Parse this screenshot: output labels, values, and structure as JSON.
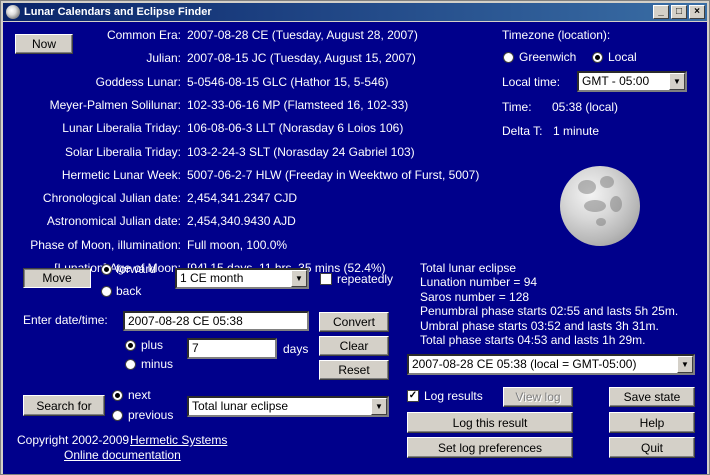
{
  "window": {
    "title": "Lunar Calendars and Eclipse Finder"
  },
  "buttons": {
    "now": "Now",
    "move": "Move",
    "convert": "Convert",
    "clear": "Clear",
    "reset": "Reset",
    "search_for": "Search for",
    "view_log": "View log",
    "save_state": "Save state",
    "log_this_result": "Log this result",
    "help": "Help",
    "set_log_preferences": "Set log preferences",
    "quit": "Quit"
  },
  "calendars": [
    {
      "label": "Common Era:",
      "value": "2007-08-28 CE (Tuesday, August 28, 2007)"
    },
    {
      "label": "Julian:",
      "value": "2007-08-15 JC (Tuesday, August 15, 2007)"
    },
    {
      "label": "Goddess Lunar:",
      "value": "5-0546-08-15 GLC (Hathor 15, 5-546)"
    },
    {
      "label": "Meyer-Palmen Solilunar:",
      "value": "102-33-06-16 MP (Flamsteed 16, 102-33)"
    },
    {
      "label": "Lunar Liberalia Triday:",
      "value": "106-08-06-3 LLT (Norasday 6 Loios 106)"
    },
    {
      "label": "Solar Liberalia Triday:",
      "value": "103-2-24-3 SLT (Norasday 24 Gabriel 103)"
    },
    {
      "label": "Hermetic Lunar Week:",
      "value": "5007-06-2-7 HLW (Freeday in Weektwo of Furst, 5007)"
    },
    {
      "label": "Chronological Julian date:",
      "value": "2,454,341.2347 CJD"
    },
    {
      "label": "Astronomical Julian date:",
      "value": "2,454,340.9430 AJD"
    },
    {
      "label": "Phase of Moon, illumination:",
      "value": "Full moon, 100.0%"
    },
    {
      "label": "[Lunation] Age of Moon:",
      "value": "[94] 15 days, 11 hrs, 35 mins (52.4%)"
    }
  ],
  "timezone": {
    "heading": "Timezone (location):",
    "greenwich_label": "Greenwich",
    "local_label": "Local",
    "selected": "local",
    "local_time_label": "Local time:",
    "local_time_value": "GMT - 05:00",
    "time_label": "Time:",
    "time_value": "05:38 (local)",
    "delta_label": "Delta T:",
    "delta_value": "1 minute"
  },
  "move": {
    "forward_label": "forward",
    "back_label": "back",
    "direction": "forward",
    "unit_value": "1 CE month",
    "repeatedly_label": "repeatedly",
    "repeatedly_checked": false
  },
  "date_entry": {
    "label": "Enter date/time:",
    "value": "2007-08-28 CE 05:38",
    "plus_label": "plus",
    "minus_label": "minus",
    "sign": "plus",
    "days_value": "7",
    "days_label": "days"
  },
  "search": {
    "next_label": "next",
    "previous_label": "previous",
    "direction": "next",
    "type_value": "Total lunar eclipse"
  },
  "eclipse": {
    "lines": [
      "Total lunar eclipse",
      "Lunation number = 94",
      "Saros number = 128",
      "Penumbral phase starts 02:55 and lasts 5h 25m.",
      "Umbral phase starts 03:52 and lasts 3h 31m.",
      "Total phase starts 04:53 and lasts 1h 29m."
    ],
    "result_select": "2007-08-28 CE 05:38 (local = GMT-05:00)"
  },
  "log": {
    "label": "Log results",
    "checked": true
  },
  "footer": {
    "copyright": "Copyright 2002-2009",
    "company_link": "Hermetic Systems",
    "docs_link": "Online documentation"
  }
}
